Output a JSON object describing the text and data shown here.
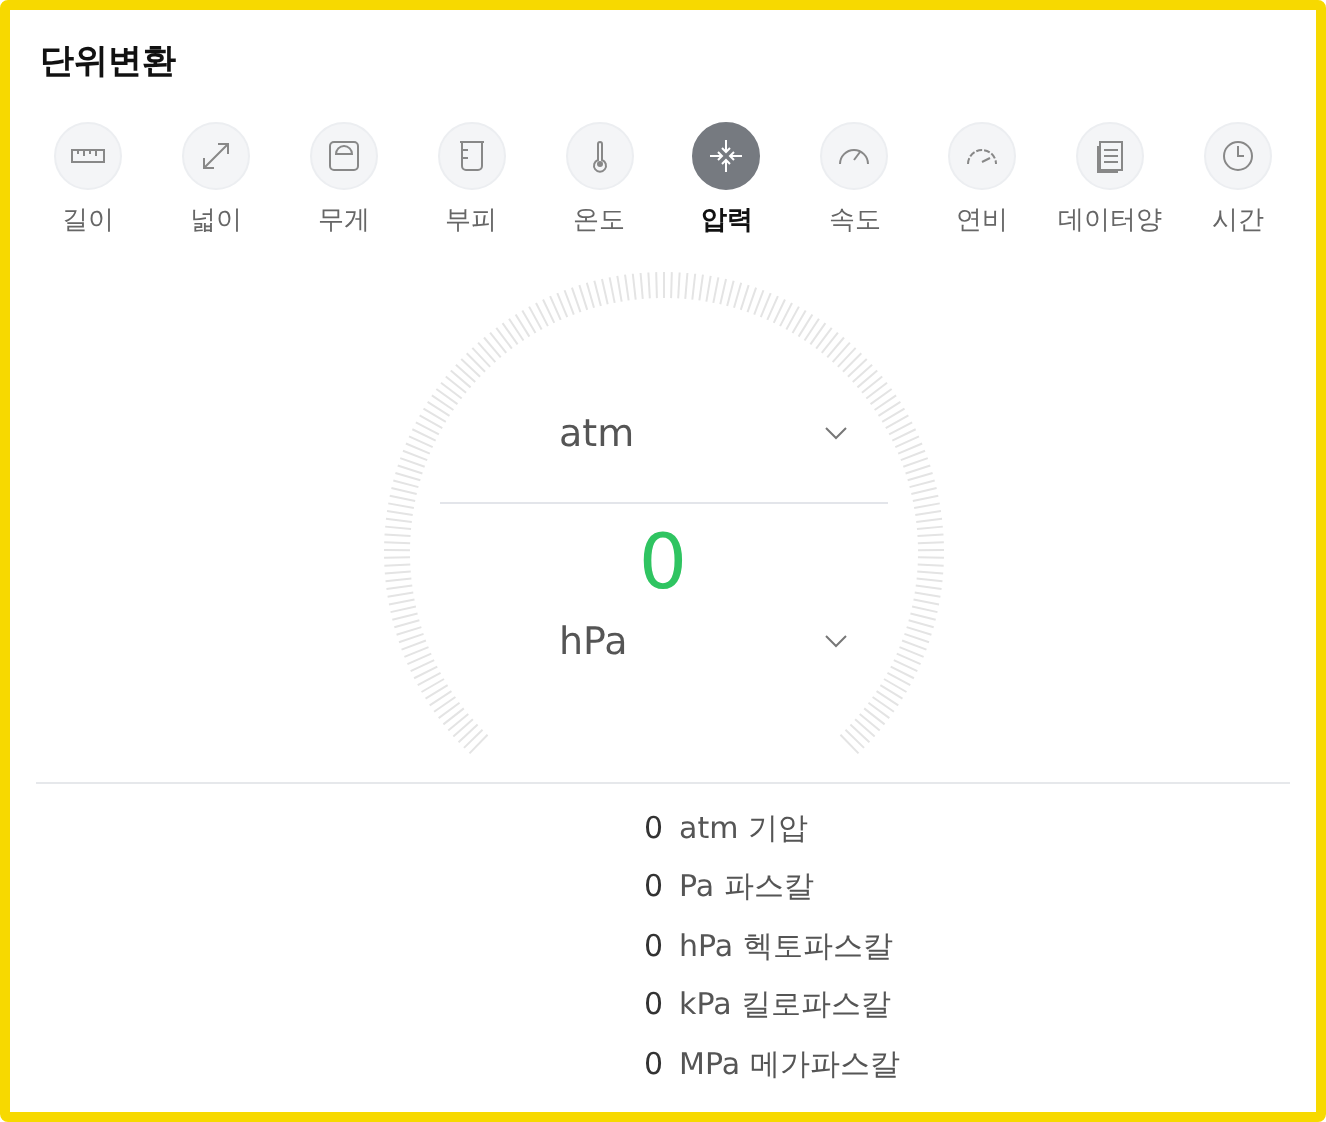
{
  "title": "단위변환",
  "categories": [
    {
      "label": "길이",
      "selected": false
    },
    {
      "label": "넓이",
      "selected": false
    },
    {
      "label": "무게",
      "selected": false
    },
    {
      "label": "부피",
      "selected": false
    },
    {
      "label": "온도",
      "selected": false
    },
    {
      "label": "압력",
      "selected": true
    },
    {
      "label": "속도",
      "selected": false
    },
    {
      "label": "연비",
      "selected": false
    },
    {
      "label": "데이터양",
      "selected": false
    },
    {
      "label": "시간",
      "selected": false
    }
  ],
  "converter": {
    "from_unit": "atm",
    "result": "0",
    "to_unit": "hPa"
  },
  "results": [
    {
      "value": "0",
      "unit": "atm",
      "name": "기압"
    },
    {
      "value": "0",
      "unit": "Pa",
      "name": "파스칼"
    },
    {
      "value": "0",
      "unit": "hPa",
      "name": "헥토파스칼"
    },
    {
      "value": "0",
      "unit": "kPa",
      "name": "킬로파스칼"
    },
    {
      "value": "0",
      "unit": "MPa",
      "name": "메가파스칼"
    }
  ]
}
